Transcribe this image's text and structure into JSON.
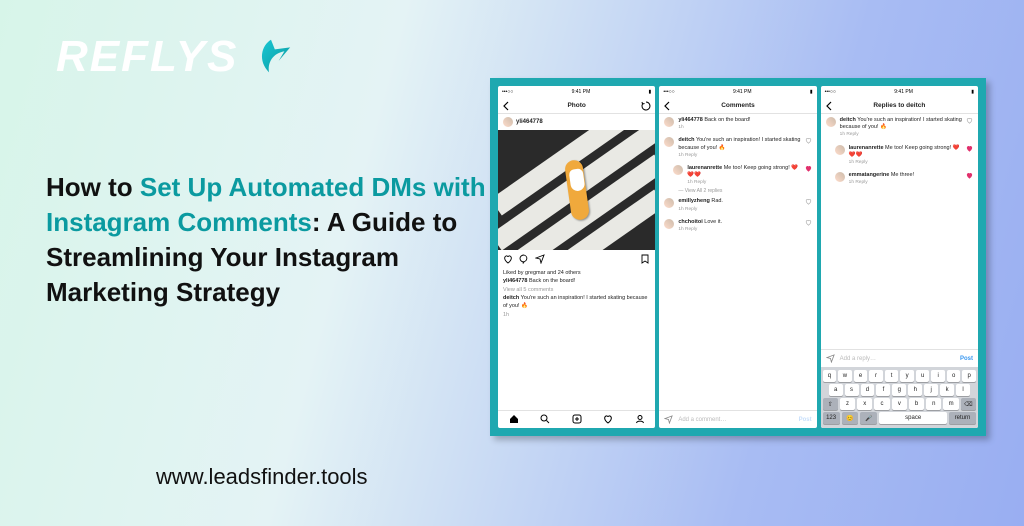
{
  "logo": {
    "text": "REFLYS"
  },
  "headline": {
    "prefix": "How to ",
    "accent": "Set Up Automated DMs with Instagram Comments",
    "suffix": ": A Guide to Streamlining Your Instagram Marketing Strategy"
  },
  "url": "www.leadsfinder.tools",
  "status": {
    "carrier": "•••○○",
    "time": "9:41 PM",
    "battery": "▮"
  },
  "phone1": {
    "title": "Photo",
    "user": "yli464778",
    "liked_by": "Liked by gregmar and 24 others",
    "caption_user": "yli464778",
    "caption_text": " Back on the board!",
    "view_comments": "View all 5 comments",
    "comment_user": "deitch",
    "comment_text": " You're such an inspiration! I started skating because of you! 🔥",
    "time": "1h"
  },
  "phone2": {
    "title": "Comments",
    "input_placeholder": "Add a comment…",
    "post_btn": "Post",
    "view_replies": "— View All 2 replies",
    "comments": [
      {
        "user": "yli464778",
        "text": " Back on the board!",
        "meta": "1h"
      },
      {
        "user": "deitch",
        "text": " You're such an inspiration! I started skating because of you! 🔥",
        "meta": "1h    Reply"
      },
      {
        "user": "laurenanrette",
        "text": " Me too! Keep going strong! ❤️❤️❤️",
        "meta": "1h    Reply",
        "nested": true
      },
      {
        "user": "emillyzheng",
        "text": " Rad.",
        "meta": "1h    Reply"
      },
      {
        "user": "chchoitoi",
        "text": " Love it.",
        "meta": "1h    Reply"
      }
    ]
  },
  "phone3": {
    "title": "Replies to deitch",
    "input_placeholder": "Add a reply…",
    "post_btn": "Post",
    "keys": {
      "r1": [
        "q",
        "w",
        "e",
        "r",
        "t",
        "y",
        "u",
        "i",
        "o",
        "p"
      ],
      "r2": [
        "a",
        "s",
        "d",
        "f",
        "g",
        "h",
        "j",
        "k",
        "l"
      ],
      "r3_shift": "⇧",
      "r3": [
        "z",
        "x",
        "c",
        "v",
        "b",
        "n",
        "m"
      ],
      "r3_del": "⌫",
      "r4_123": "123",
      "r4_emoji": "😊",
      "r4_mic": "🎤",
      "r4_space": "space",
      "r4_return": "return"
    },
    "replies": [
      {
        "user": "deitch",
        "text": " You're such an inspiration! I started skating because of you! 🔥",
        "meta": "1h    Reply"
      },
      {
        "user": "laurenanrette",
        "text": " Me too! Keep going strong! ❤️❤️❤️",
        "meta": "1h    Reply",
        "nested": true
      },
      {
        "user": "emmatangerine",
        "text": " Me three!",
        "meta": "1h    Reply",
        "nested": true
      }
    ]
  }
}
